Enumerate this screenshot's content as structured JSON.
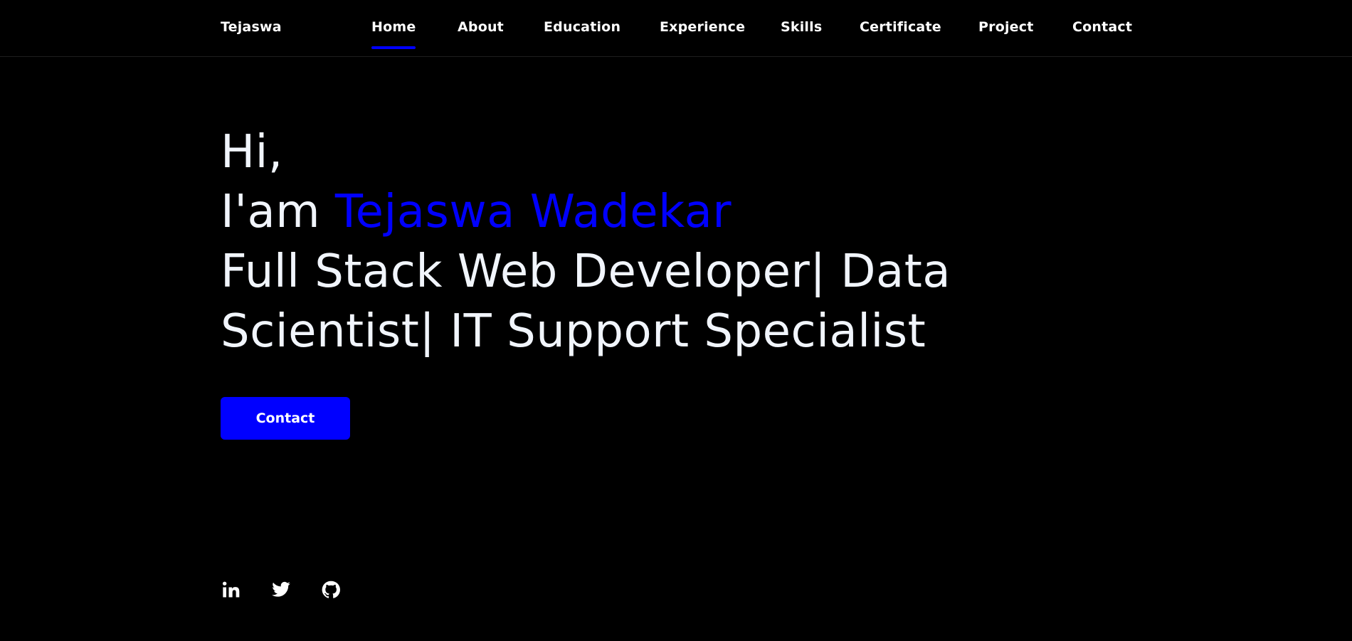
{
  "colors": {
    "accent": "#0000ff",
    "background": "#000000",
    "text": "#f1f5fc"
  },
  "header": {
    "logo": "Tejaswa",
    "nav": [
      {
        "label": "Home",
        "active": true
      },
      {
        "label": "About"
      },
      {
        "label": "Education"
      },
      {
        "label": "Experience"
      },
      {
        "label": "Skills"
      },
      {
        "label": "Certificate"
      },
      {
        "label": "Project"
      },
      {
        "label": "Contact"
      }
    ]
  },
  "hero": {
    "greeting": "Hi,",
    "intro_prefix": "I'am ",
    "name": "Tejaswa Wadekar",
    "title_line1": "Full Stack Web Developer| Data",
    "title_line2": "Scientist| IT Support Specialist",
    "button_label": "Contact"
  },
  "social": {
    "icons": [
      "linkedin-icon",
      "twitter-icon",
      "github-icon"
    ]
  }
}
